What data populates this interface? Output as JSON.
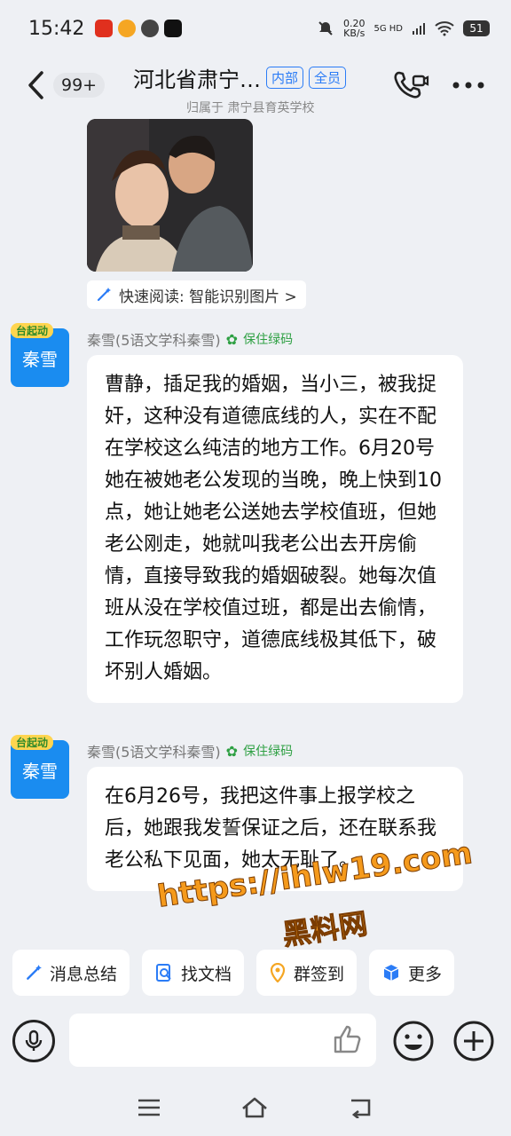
{
  "status_bar": {
    "time": "15:42",
    "net_speed_value": "0.20",
    "net_speed_unit": "KB/s",
    "signal": "5G HD",
    "battery": "51"
  },
  "header": {
    "unread_count": "99+",
    "title": "河北省肃宁…",
    "tag_internal": "内部",
    "tag_all": "全员",
    "subtitle": "归属于 肃宁县育英学校"
  },
  "chat": {
    "quick_read": "快速阅读: 智能识别图片 >",
    "messages": [
      {
        "avatar_text": "秦雪",
        "avatar_crown": "台起动",
        "sender": "秦雪(5语文学科秦雪)",
        "health": "保住绿码",
        "text": "曹静，插足我的婚姻，当小三，被我捉奸，这种没有道德底线的人，实在不配在学校这么纯洁的地方工作。6月20号她在被她老公发现的当晚，晚上快到10点，她让她老公送她去学校值班，但她老公刚走，她就叫我老公出去开房偷情，直接导致我的婚姻破裂。她每次值班从没在学校值过班，都是出去偷情，工作玩忽职守，道德底线极其低下，破坏别人婚姻。"
      },
      {
        "avatar_text": "秦雪",
        "avatar_crown": "台起动",
        "sender": "秦雪(5语文学科秦雪)",
        "health": "保住绿码",
        "text": "在6月26号，我把这件事上报学校之后，她跟我发誓保证之后，还在联系我老公私下见面，她太无耻了。"
      }
    ]
  },
  "watermark": {
    "url": "https://ihlw19.com",
    "name": "黑料网"
  },
  "toolbar": {
    "summary": "消息总结",
    "find_doc": "找文档",
    "checkin": "群签到",
    "more": "更多"
  },
  "colors": {
    "accent": "#2b7cf6",
    "avatar": "#1a8cf0",
    "health": "#2ea043",
    "watermark": "#f59a1c"
  }
}
